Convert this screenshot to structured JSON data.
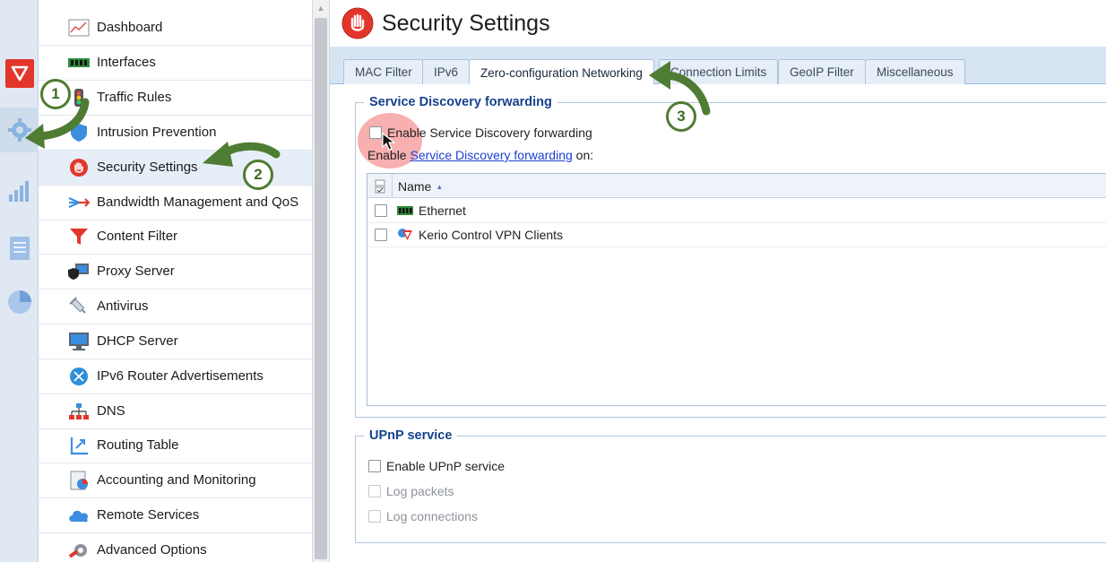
{
  "page": {
    "title": "Security Settings"
  },
  "nav": {
    "items": [
      {
        "label": "Dashboard",
        "icon": "dashboard-icon"
      },
      {
        "label": "Interfaces",
        "icon": "interfaces-icon"
      },
      {
        "label": "Traffic Rules",
        "icon": "traffic-rules-icon"
      },
      {
        "label": "Intrusion Prevention",
        "icon": "intrusion-prevention-icon"
      },
      {
        "label": "Security Settings",
        "icon": "security-settings-icon",
        "selected": true
      },
      {
        "label": "Bandwidth Management and QoS",
        "icon": "bandwidth-icon"
      },
      {
        "label": "Content Filter",
        "icon": "content-filter-icon"
      },
      {
        "label": "Proxy Server",
        "icon": "proxy-server-icon"
      },
      {
        "label": "Antivirus",
        "icon": "antivirus-icon"
      },
      {
        "label": "DHCP Server",
        "icon": "dhcp-server-icon"
      },
      {
        "label": "IPv6 Router Advertisements",
        "icon": "ipv6-router-icon"
      },
      {
        "label": "DNS",
        "icon": "dns-icon"
      },
      {
        "label": "Routing Table",
        "icon": "routing-table-icon"
      },
      {
        "label": "Accounting and Monitoring",
        "icon": "accounting-icon"
      },
      {
        "label": "Remote Services",
        "icon": "remote-services-icon"
      },
      {
        "label": "Advanced Options",
        "icon": "advanced-options-icon"
      }
    ]
  },
  "tabs": [
    {
      "label": "MAC Filter"
    },
    {
      "label": "IPv6"
    },
    {
      "label": "Zero-configuration Networking",
      "active": true
    },
    {
      "label": "Connection Limits"
    },
    {
      "label": "GeoIP Filter"
    },
    {
      "label": "Miscellaneous"
    }
  ],
  "service_discovery": {
    "legend": "Service Discovery forwarding",
    "enable_label": "Enable Service Discovery forwarding",
    "enable_on_prefix": "Enable ",
    "enable_on_link": "Service Discovery forwarding",
    "enable_on_suffix": " on:",
    "grid": {
      "column_name": "Name",
      "rows": [
        {
          "name": "Ethernet",
          "icon": "ethernet-icon"
        },
        {
          "name": "Kerio Control VPN Clients",
          "icon": "vpn-clients-icon"
        }
      ]
    }
  },
  "upnp": {
    "legend": "UPnP service",
    "enable_label": "Enable UPnP service",
    "log_packets_label": "Log packets",
    "log_connections_label": "Log connections"
  },
  "steps": [
    "1",
    "2",
    "3"
  ],
  "colors": {
    "accent": "#15428b",
    "tab_bar": "#d7e4f3",
    "step_green": "#4f7c33",
    "brand_red": "#e2362b"
  }
}
